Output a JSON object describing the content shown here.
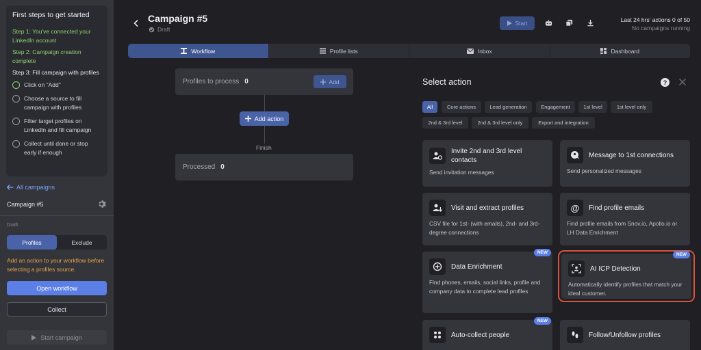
{
  "sidebar": {
    "steps_title": "First steps to get started",
    "steps": [
      {
        "text": "Step 1: You've connected your LinkedIn account",
        "state": "done"
      },
      {
        "text": "Step 2: Campaign creation complete",
        "state": "done"
      },
      {
        "text": "Step 3: Fill campaign with profiles",
        "state": "current"
      }
    ],
    "sub_steps": [
      {
        "text": "Click on \"Add\""
      },
      {
        "text": "Choose a source to fill campaign with profiles"
      },
      {
        "text": "Filter target profiles on LinkedIn and fill campaign"
      },
      {
        "text": "Collect until done or stop early if enough"
      }
    ],
    "all_campaigns": "All campaigns",
    "campaign_name": "Campaign #5",
    "status": "Draft",
    "segment": {
      "profiles": "Profiles",
      "exclude": "Exclude"
    },
    "warning": "Add an action to your workflow before selecting a profiles source.",
    "open_workflow": "Open workflow",
    "collect": "Collect",
    "start_campaign": "Start campaign"
  },
  "header": {
    "title": "Campaign #5",
    "subtitle": "Draft",
    "start": "Start",
    "actions_line1": "Last 24 hrs' actions 0 of 50",
    "actions_line2": "No campaigns running"
  },
  "tabs": [
    {
      "label": "Workflow",
      "icon": "workflow-icon"
    },
    {
      "label": "Profile lists",
      "icon": "list-icon"
    },
    {
      "label": "Inbox",
      "icon": "mail-icon"
    },
    {
      "label": "Dashboard",
      "icon": "dashboard-icon"
    }
  ],
  "workflow": {
    "profiles_to_process_label": "Profiles to process",
    "profiles_to_process_count": "0",
    "add": "Add",
    "add_action": "Add action",
    "finish": "Finish",
    "processed_label": "Processed",
    "processed_count": "0"
  },
  "select_action": {
    "title": "Select action",
    "help": "?",
    "filters": [
      "All",
      "Core actions",
      "Lead generation",
      "Engagement",
      "1st level",
      "1st level only",
      "2nd & 3rd level",
      "2nd & 3rd level only",
      "Export and integration"
    ],
    "new_badge": "NEW",
    "cards": [
      {
        "title": "Invite 2nd and 3rd level contacts",
        "desc": "Send invitation messages",
        "icon": "invite-icon"
      },
      {
        "title": "Message to 1st connections",
        "desc": "Send personalized messages",
        "icon": "message-icon"
      },
      {
        "title": "Visit and extract profiles",
        "desc": "CSV file for 1st- (with emails), 2nd- and 3rd-degree connections",
        "icon": "visit-icon"
      },
      {
        "title": "Find profile emails",
        "desc": "Find profile emails from Snov.io, Apollo.io or LH Data Enrichment",
        "icon": "at-icon"
      },
      {
        "title": "Data Enrichment",
        "desc": "Find phones, emails, social links, profile and company data to complete lead profiles",
        "icon": "enrich-icon"
      },
      {
        "title": "AI ICP Detection",
        "desc": "Automatically identify profiles that match your ideal customer.",
        "icon": "ai-icon"
      },
      {
        "title": "Auto-collect people",
        "desc": "",
        "icon": "people-icon"
      },
      {
        "title": "Follow/Unfollow profiles",
        "desc": "",
        "icon": "follow-icon"
      }
    ]
  },
  "colors": {
    "accent": "#5b7fe6",
    "done_step": "#8fcf72",
    "warning": "#e3a24a",
    "highlight": "#d9533d"
  }
}
